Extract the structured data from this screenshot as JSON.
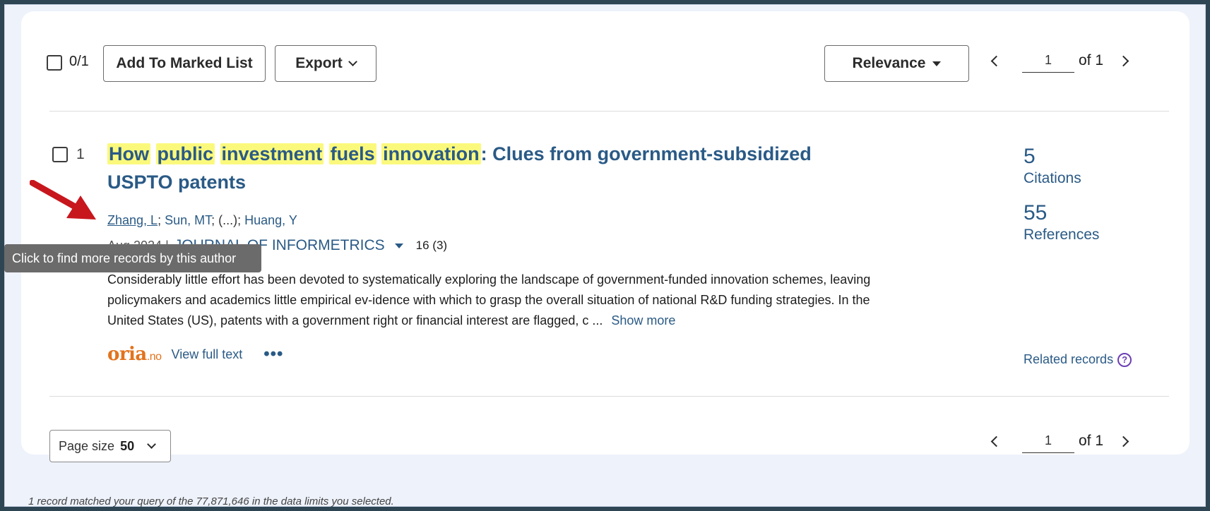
{
  "toolbar": {
    "select_count": "0/1",
    "add_to_marked_list": "Add To Marked List",
    "export": "Export",
    "sort": "Relevance",
    "page": "1",
    "of_label": "of 1"
  },
  "record": {
    "number": "1",
    "title_highlight": [
      "How",
      "public",
      "investment",
      "fuels",
      "innovation"
    ],
    "title_rest": ": Clues from government-subsidized USPTO patents",
    "authors": {
      "first": "Zhang, L",
      "second": "Sun, MT",
      "ellipsis": "(...)",
      "last": "Huang, Y"
    },
    "date": "Aug 2024 |",
    "journal": "JOURNAL OF INFORMETRICS",
    "volume": "16 (3)",
    "tooltip": "Click to find more records by this author",
    "abstract": "Considerably little effort has been devoted to systematically exploring the landscape of government-funded innovation schemes, leaving policymakers and academics little empirical ev-idence with which to grasp the overall situation of national R&D funding strategies. In the United States (US), patents with a government right or financial interest are flagged, c ...",
    "show_more": "Show more",
    "oria_logo": "oria",
    "oria_suffix": ".no",
    "view_full_text": "View full text",
    "more": "•••",
    "citations_count": "5",
    "citations_label": "Citations",
    "references_count": "55",
    "references_label": "References",
    "related_records": "Related records",
    "help": "?"
  },
  "bottom": {
    "page_size_label": "Page size",
    "page_size_value": "50",
    "page": "1",
    "of_label": "of 1"
  },
  "footer_note": "1 record matched your query of the 77,871,646 in the data limits you selected.",
  "colors": {
    "accent": "#2a5a86",
    "highlight": "#fbf97c",
    "annotation_arrow": "#c8161d",
    "oria": "#e2731d"
  }
}
